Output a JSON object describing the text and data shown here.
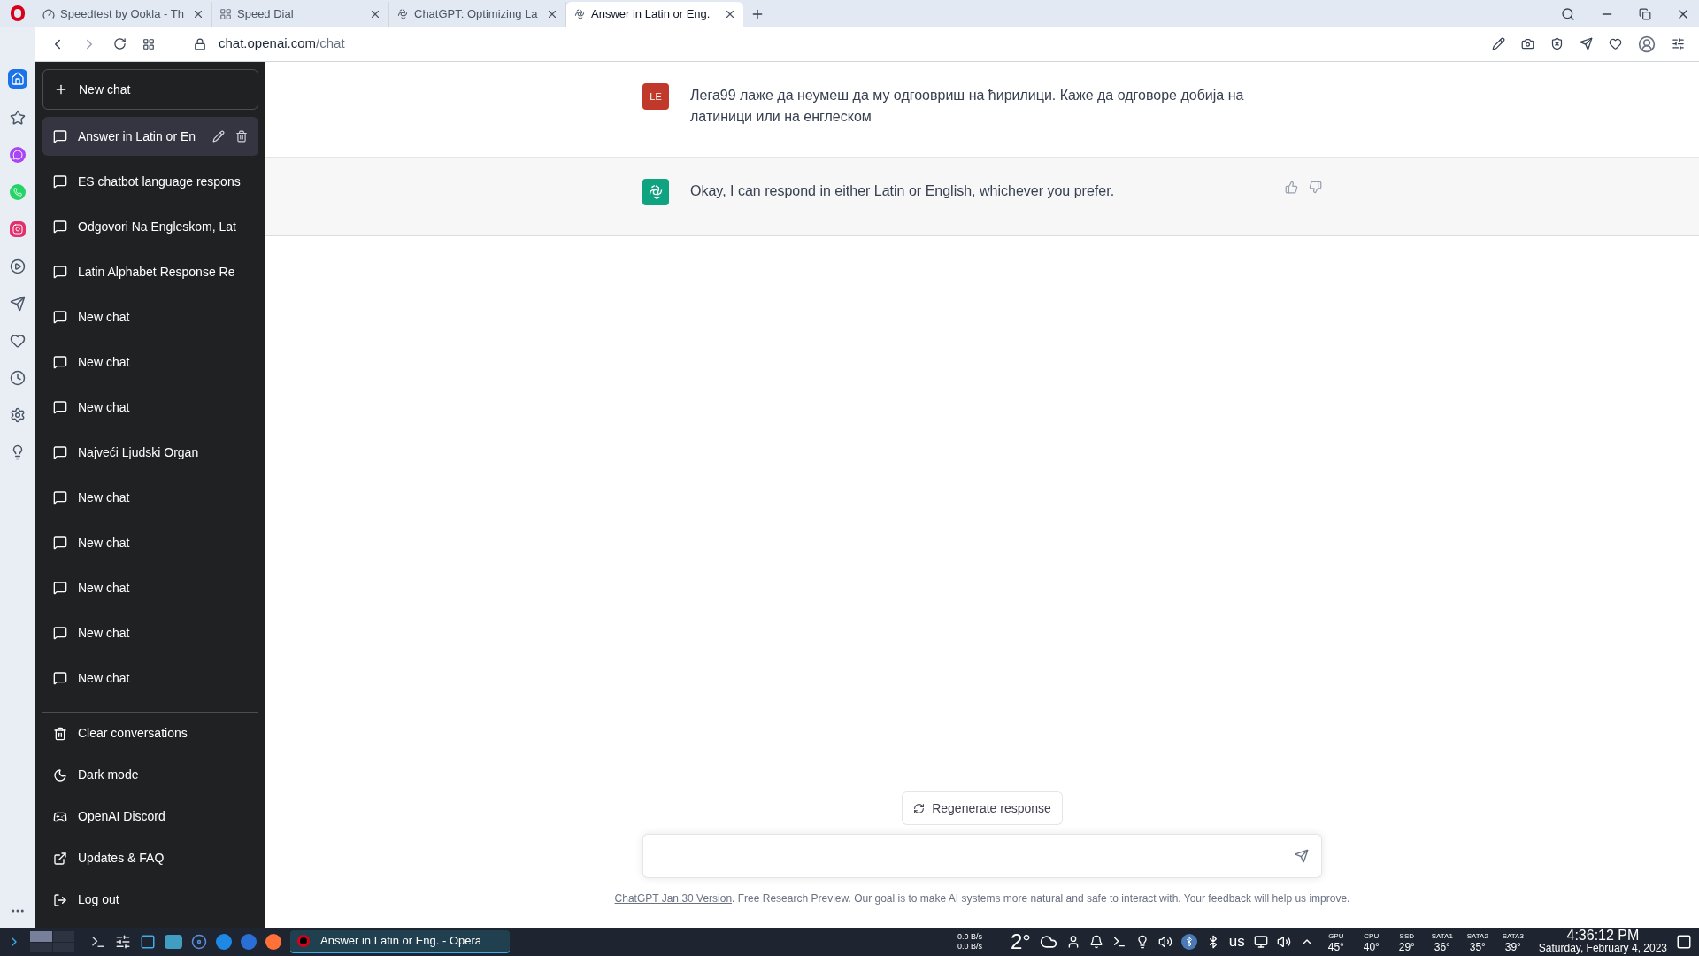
{
  "browser": {
    "tabs": [
      {
        "label": "Speedtest by Ookla - Th",
        "selected": false,
        "kind": "gauge"
      },
      {
        "label": "Speed Dial",
        "selected": false,
        "kind": "grid"
      },
      {
        "label": "ChatGPT: Optimizing La",
        "selected": false,
        "kind": "openai"
      },
      {
        "label": "Answer in Latin or Eng.",
        "selected": true,
        "kind": "openai"
      }
    ],
    "url_host": "chat.openai.com",
    "url_path": "/chat"
  },
  "opera_sidebar": [
    {
      "kind": "home",
      "selected": true
    },
    {
      "kind": "star",
      "selected": false
    },
    {
      "kind": "messenger",
      "selected": false
    },
    {
      "kind": "whatsapp",
      "selected": false
    },
    {
      "kind": "instagram",
      "selected": false
    },
    {
      "kind": "player",
      "selected": false
    },
    {
      "kind": "send",
      "selected": false
    },
    {
      "kind": "heart",
      "selected": false
    },
    {
      "kind": "clock",
      "selected": false
    },
    {
      "kind": "settings",
      "selected": false
    },
    {
      "kind": "bulb",
      "selected": false
    }
  ],
  "sidebar": {
    "new_chat": "New chat",
    "conversations": [
      {
        "title": "Answer in Latin or En",
        "selected": true
      },
      {
        "title": "ES chatbot language respons",
        "selected": false
      },
      {
        "title": "Odgovori Na Engleskom, Lat",
        "selected": false
      },
      {
        "title": "Latin Alphabet Response Re",
        "selected": false
      },
      {
        "title": "New chat",
        "selected": false
      },
      {
        "title": "New chat",
        "selected": false
      },
      {
        "title": "New chat",
        "selected": false
      },
      {
        "title": "Najveći Ljudski Organ",
        "selected": false
      },
      {
        "title": "New chat",
        "selected": false
      },
      {
        "title": "New chat",
        "selected": false
      },
      {
        "title": "New chat",
        "selected": false
      },
      {
        "title": "New chat",
        "selected": false
      },
      {
        "title": "New chat",
        "selected": false
      }
    ],
    "actions": [
      {
        "label": "Clear conversations",
        "kind": "trash"
      },
      {
        "label": "Dark mode",
        "kind": "moon"
      },
      {
        "label": "OpenAI Discord",
        "kind": "discord"
      },
      {
        "label": "Updates & FAQ",
        "kind": "external"
      },
      {
        "label": "Log out",
        "kind": "logout"
      }
    ]
  },
  "messages": [
    {
      "kind": "user",
      "avatar": "LE",
      "text": "Лега99 лаже да неумеш да му одгоовриш на ћирилици. Каже да одговоре добија на латиници или на енглеском"
    },
    {
      "kind": "assistant",
      "text": "Okay, I can respond in either Latin or English, whichever you prefer."
    }
  ],
  "regenerate": "Regenerate response",
  "footer": {
    "link": "ChatGPT Jan 30 Version",
    "text": ". Free Research Preview. Our goal is to make AI systems more natural and safe to interact with. Your feedback will help us improve."
  },
  "taskbar": {
    "window": "Answer in Latin or Eng. - Opera",
    "net_down": "0.0 B/s",
    "net_up": "0.0 B/s",
    "weather": "2°",
    "keyboard": "us",
    "sensors": [
      {
        "name": "GPU",
        "value": "45°"
      },
      {
        "name": "CPU",
        "value": "40°"
      },
      {
        "name": "SSD",
        "value": "29°"
      },
      {
        "name": "SATA1",
        "value": "36°"
      },
      {
        "name": "SATA2",
        "value": "35°"
      },
      {
        "name": "SATA3",
        "value": "39°"
      }
    ],
    "time": "4:36:12 PM",
    "date": "Saturday, February 4, 2023"
  }
}
